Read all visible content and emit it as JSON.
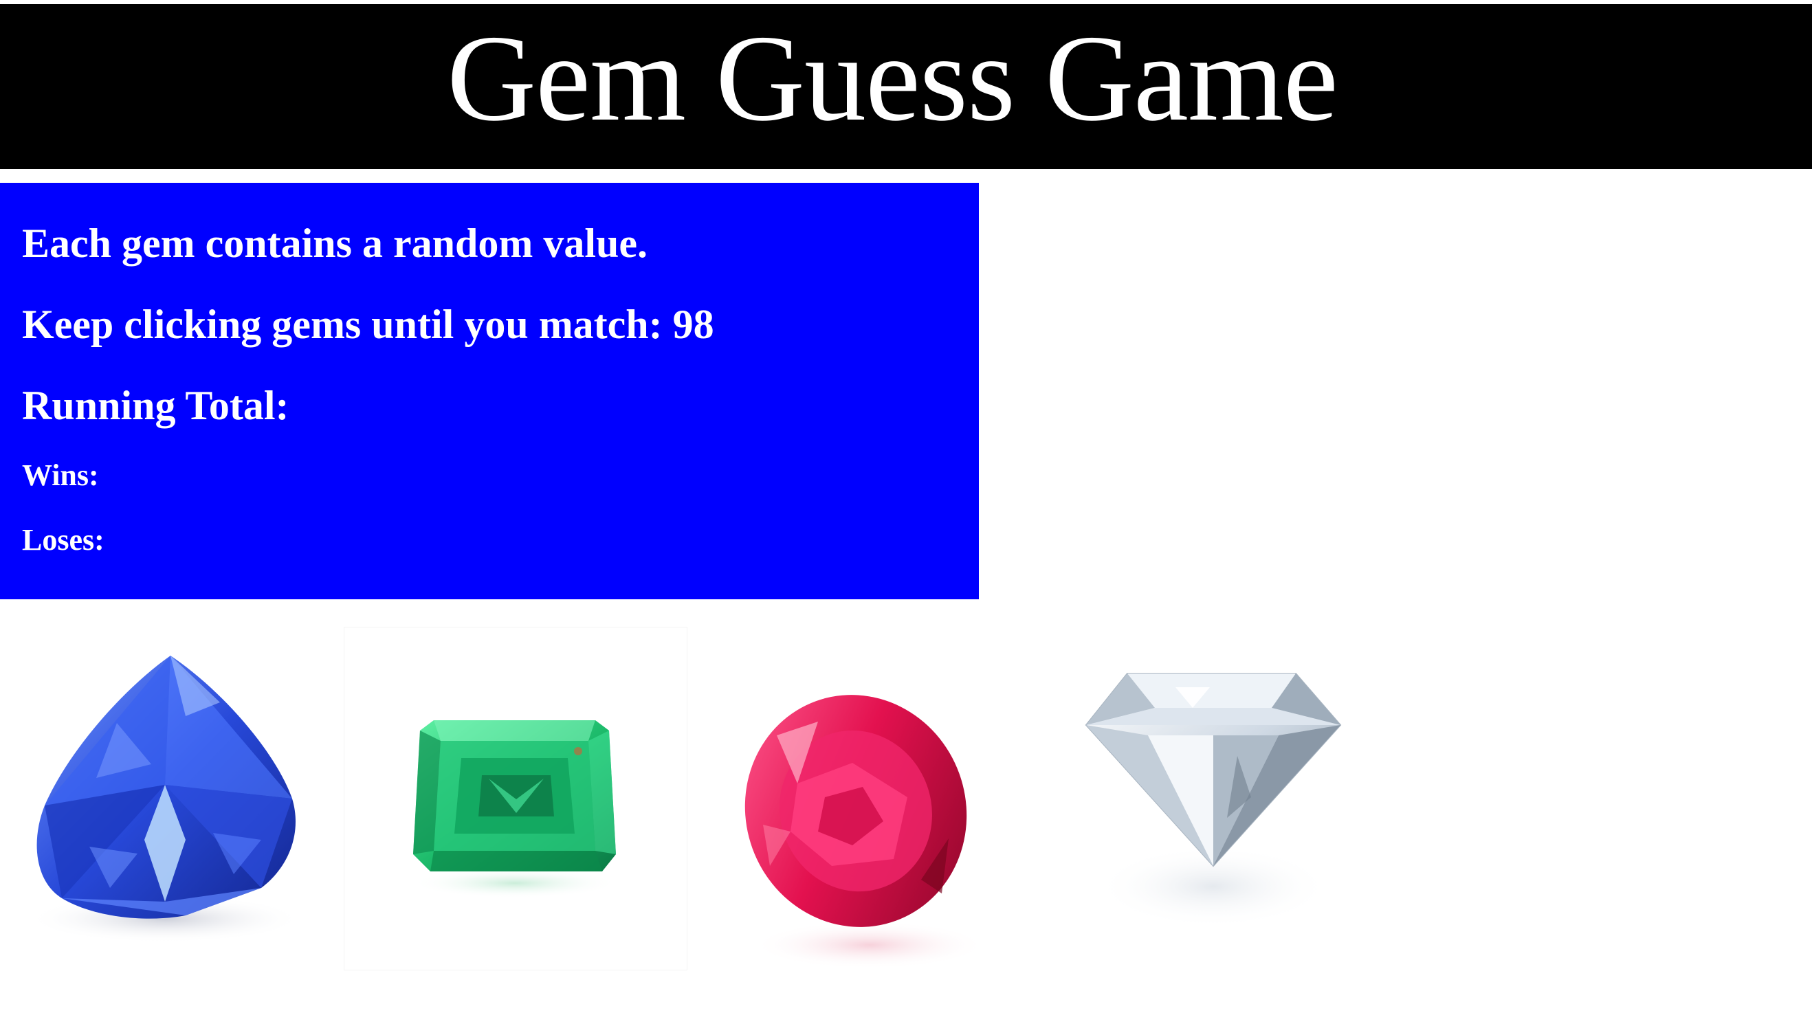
{
  "header": {
    "title": "Gem Guess Game"
  },
  "info": {
    "line1": "Each gem contains a random value.",
    "line2_prefix": "Keep clicking gems until you match: ",
    "target": "98",
    "running_total_label": "Running Total:",
    "running_total_value": "",
    "wins_label": "Wins:",
    "wins_value": "",
    "loses_label": "Loses:",
    "loses_value": ""
  },
  "gems": [
    {
      "name": "sapphire",
      "color": "#2a4fd6"
    },
    {
      "name": "emerald",
      "color": "#1fbf6a"
    },
    {
      "name": "ruby",
      "color": "#e0104f"
    },
    {
      "name": "diamond",
      "color": "#d8e2ec"
    }
  ],
  "colors": {
    "header_bg": "#000000",
    "panel_bg": "#0000ff",
    "text": "#ffffff"
  }
}
